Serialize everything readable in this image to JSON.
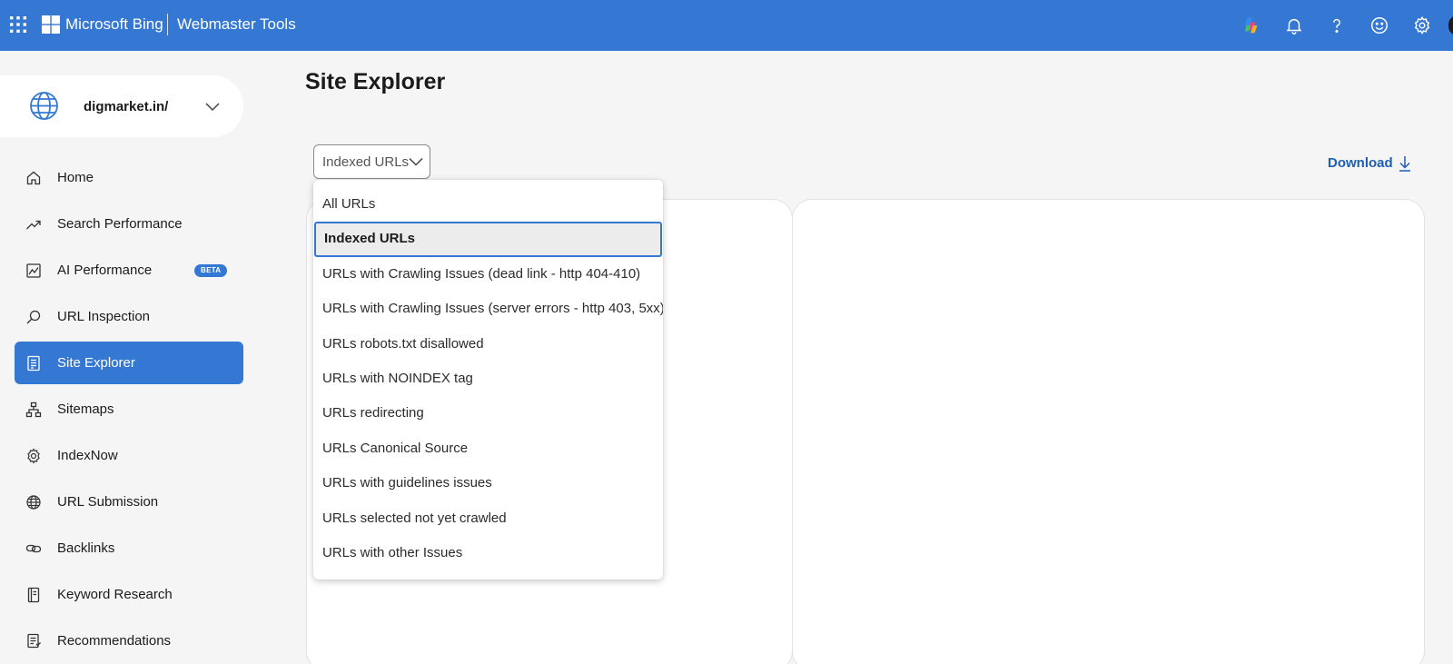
{
  "topbar": {
    "brand": "Microsoft Bing",
    "product": "Webmaster Tools",
    "icons": [
      "waffle-icon",
      "copilot-icon",
      "bell-icon",
      "help-icon",
      "smiley-icon",
      "gear-icon"
    ],
    "background": "#3578d4"
  },
  "site": {
    "name": "digmarket.in/"
  },
  "sidebar": {
    "items": [
      {
        "label": "Home",
        "icon": "home-icon"
      },
      {
        "label": "Search Performance",
        "icon": "trending-icon"
      },
      {
        "label": "AI Performance",
        "icon": "chart-icon",
        "badge": "BETA"
      },
      {
        "label": "URL Inspection",
        "icon": "search-icon"
      },
      {
        "label": "Site Explorer",
        "icon": "document-icon",
        "active": true
      },
      {
        "label": "Sitemaps",
        "icon": "sitemap-icon"
      },
      {
        "label": "IndexNow",
        "icon": "gear-icon"
      },
      {
        "label": "URL Submission",
        "icon": "globe-icon"
      },
      {
        "label": "Backlinks",
        "icon": "link-icon"
      },
      {
        "label": "Keyword Research",
        "icon": "notebook-icon"
      },
      {
        "label": "Recommendations",
        "icon": "checklist-icon"
      }
    ]
  },
  "main": {
    "title": "Site Explorer",
    "filter": {
      "selected": "Indexed URLs",
      "options": [
        "All URLs",
        "Indexed URLs",
        "URLs with Crawling Issues (dead link - http 404-410)",
        "URLs with Crawling Issues (server errors - http 403, 5xx)",
        "URLs robots.txt disallowed",
        "URLs with NOINDEX tag",
        "URLs redirecting",
        "URLs Canonical Source",
        "URLs with guidelines issues",
        "URLs selected not yet crawled",
        "URLs with other Issues"
      ]
    },
    "download_label": "Download"
  }
}
